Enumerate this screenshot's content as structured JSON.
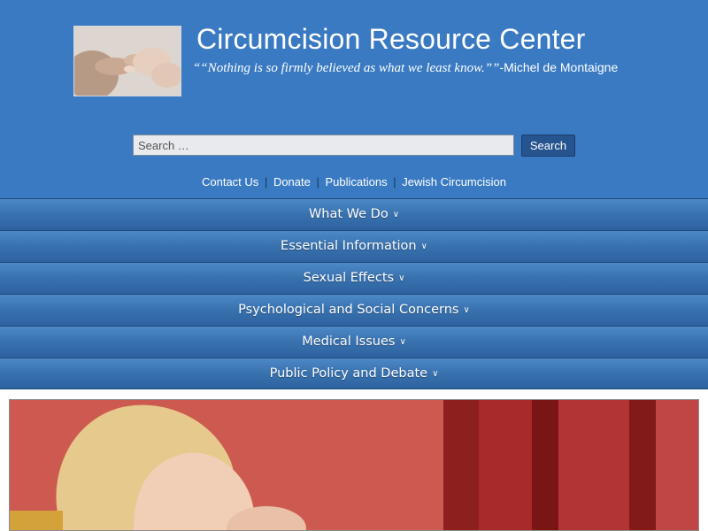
{
  "header": {
    "title": "Circumcision Resource Center",
    "tagline_quote": "““Nothing is so firmly believed as what we least know.””",
    "tagline_author": "-Michel de Montaigne",
    "logo_image": "hands-photo"
  },
  "search": {
    "placeholder": "Search …",
    "button_label": "Search"
  },
  "top_links": [
    {
      "label": "Contact Us"
    },
    {
      "label": "Donate"
    },
    {
      "label": "Publications"
    },
    {
      "label": "Jewish Circumcision"
    }
  ],
  "link_separator": "|",
  "nav": [
    {
      "label": "What We Do"
    },
    {
      "label": "Essential Information"
    },
    {
      "label": "Sexual Effects"
    },
    {
      "label": "Psychological and Social Concerns"
    },
    {
      "label": "Medical Issues"
    },
    {
      "label": "Public Policy and Debate"
    }
  ],
  "hero_image": "mother-with-infant-photo",
  "colors": {
    "header_bg": "#3a7ac2",
    "nav_bg": "#3a73b0",
    "button_bg": "#26548f"
  }
}
